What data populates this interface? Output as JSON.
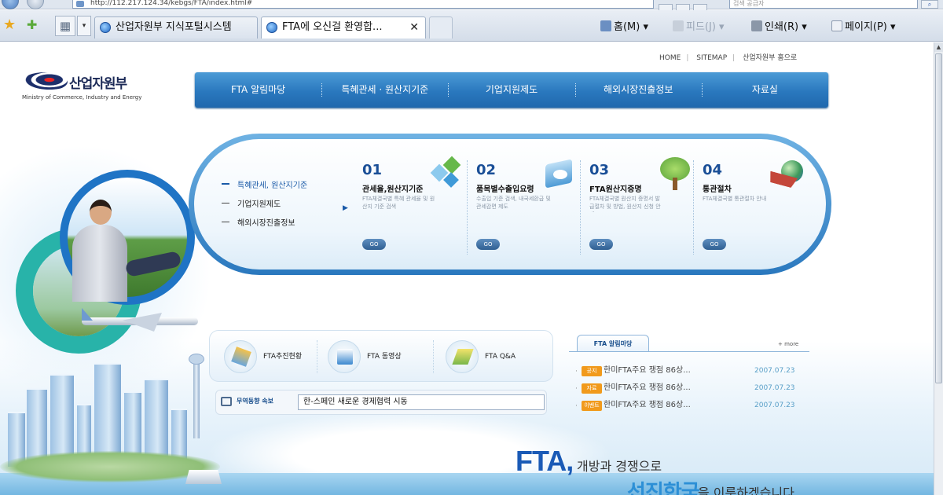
{
  "browser": {
    "address": "http://112.217.124.34/kebgs/FTA/index.html#",
    "search_placeholder": "검색 공급자",
    "tabs": [
      {
        "label": "산업자원부 지식포털시스템"
      },
      {
        "label": "FTA에 오신걸 환영합..."
      }
    ],
    "toolbar": {
      "home": "홈(M)",
      "feeds": "피드(J)",
      "print": "인쇄(R)",
      "page": "페이지(P)"
    }
  },
  "site": {
    "util_nav": [
      "HOME",
      "SITEMAP",
      "산업자원부 홈으로"
    ],
    "logo": {
      "kr": "산업자원부",
      "en": "Ministry of Commerce, Industry and Energy"
    },
    "gnb": [
      "FTA 알림마당",
      "특혜관세 · 원산지기준",
      "기업지원제도",
      "해외시장진출정보",
      "자료실"
    ],
    "quick_list": [
      "특혜관세, 원산지기준",
      "기업지원제도",
      "해외시장진출정보"
    ],
    "quick_cards": [
      {
        "num": "01",
        "title": "관세율,원산지기준",
        "desc": "FTA체결국별 특혜 관세율 및 원산지 기준 검색",
        "go": "GO"
      },
      {
        "num": "02",
        "title": "품목별수출입요령",
        "desc": "수출입 기준 검색, 내국세환급 및 관세감면 제도",
        "go": "GO"
      },
      {
        "num": "03",
        "title": "FTA원산지증명",
        "desc": "FTA체결국별 원산지 증명서 발급절차 및 방법, 원산지 신청 안내",
        "go": "GO"
      },
      {
        "num": "04",
        "title": "통관절차",
        "desc": "FTA체결국별 통관절차 안내",
        "go": "GO"
      }
    ],
    "fta_links": [
      "FTA추진현황",
      "FTA 동영상",
      "FTA Q&A"
    ],
    "ticker": {
      "label": "무역동향 속보",
      "value": "한-스페인 새로운 경제협력 시동"
    },
    "notice": {
      "tab": "FTA 알림마당",
      "more": "+ more",
      "items": [
        {
          "badge": "공지",
          "title": "한미FTA주요 쟁점 86상...",
          "date": "2007.07.23"
        },
        {
          "badge": "자료",
          "title": "한미FTA주요 쟁점 86상...",
          "date": "2007.07.23"
        },
        {
          "badge": "이벤트",
          "title": "한미FTA주요 쟁점 86상...",
          "date": "2007.07.23"
        }
      ]
    },
    "slogan": {
      "fta": "FTA,",
      "line1": "개방과 경쟁으로",
      "line2": "선진한국",
      "line3": "을 이룩하겠습니다."
    }
  },
  "colors": {
    "gnb": "#2a78be",
    "accent": "#1a5ab6",
    "badge_orange": "#f19a1c",
    "teal": "#28b3a9"
  }
}
